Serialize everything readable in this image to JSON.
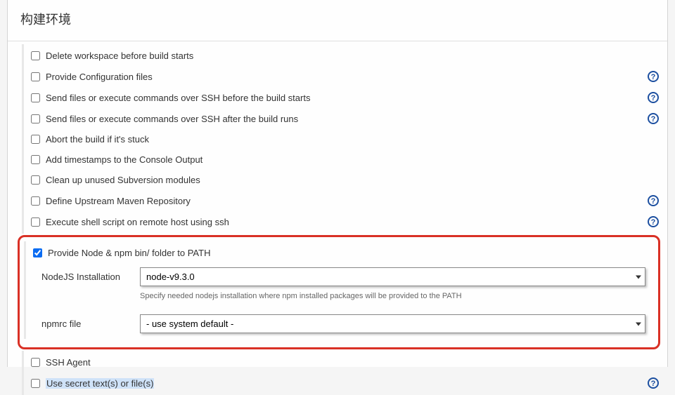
{
  "section_title": "构建环境",
  "options": [
    {
      "id": "delete-workspace",
      "label": "Delete workspace before build starts",
      "checked": false,
      "help": false
    },
    {
      "id": "provide-config",
      "label": "Provide Configuration files",
      "checked": false,
      "help": true
    },
    {
      "id": "send-ssh-before",
      "label": "Send files or execute commands over SSH before the build starts",
      "checked": false,
      "help": true
    },
    {
      "id": "send-ssh-after",
      "label": "Send files or execute commands over SSH after the build runs",
      "checked": false,
      "help": true
    },
    {
      "id": "abort-stuck",
      "label": "Abort the build if it's stuck",
      "checked": false,
      "help": false
    },
    {
      "id": "add-timestamps",
      "label": "Add timestamps to the Console Output",
      "checked": false,
      "help": false
    },
    {
      "id": "cleanup-svn",
      "label": "Clean up unused Subversion modules",
      "checked": false,
      "help": false
    },
    {
      "id": "define-upstream",
      "label": "Define Upstream Maven Repository",
      "checked": false,
      "help": true
    },
    {
      "id": "execute-shell-ssh",
      "label": "Execute shell script on remote host using ssh",
      "checked": false,
      "help": true
    }
  ],
  "node_npm": {
    "label": "Provide Node & npm bin/ folder to PATH",
    "checked": true,
    "fields": {
      "nodejs_label": "NodeJS Installation",
      "nodejs_value": "node-v9.3.0",
      "nodejs_hint": "Specify needed nodejs installation where npm installed packages will be provided to the PATH",
      "npmrc_label": "npmrc file",
      "npmrc_value": "- use system default -"
    }
  },
  "after_options": [
    {
      "id": "ssh-agent",
      "label": "SSH Agent",
      "checked": false,
      "help": false,
      "special": false
    },
    {
      "id": "use-secret",
      "label": "Use secret text(s) or file(s)",
      "checked": false,
      "help": true,
      "special": true
    }
  ]
}
